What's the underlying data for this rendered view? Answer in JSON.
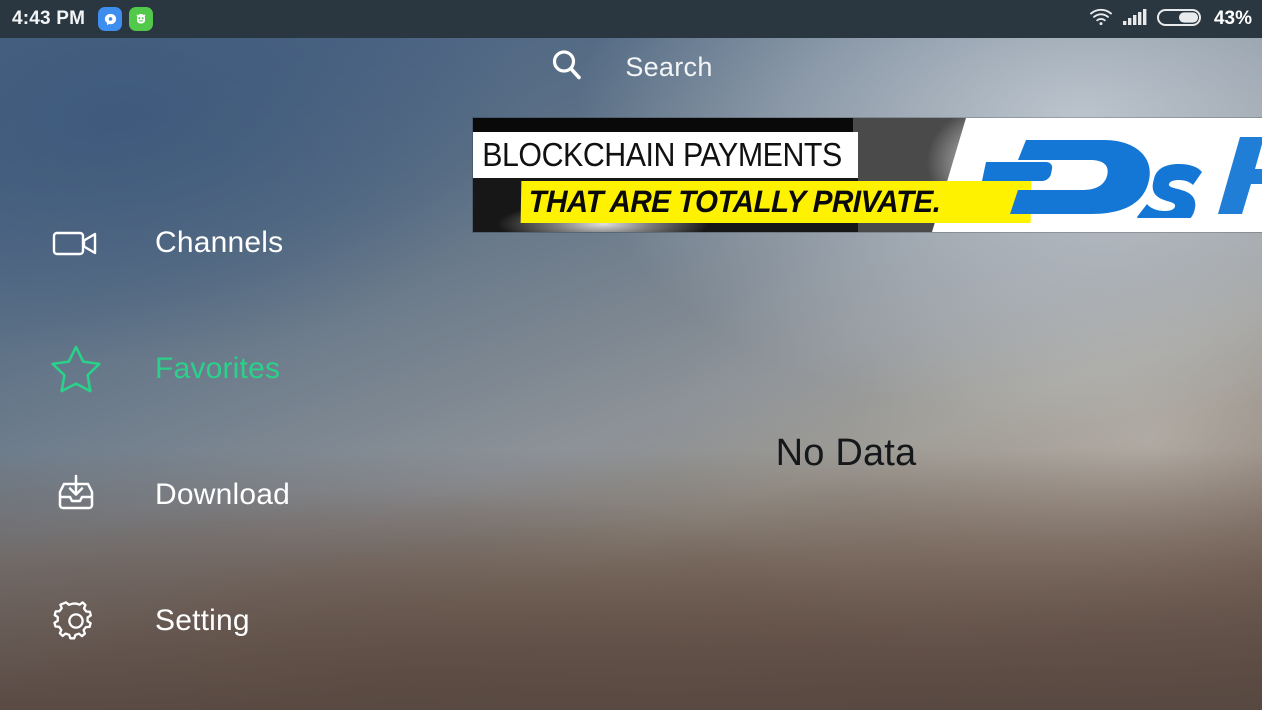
{
  "status_bar": {
    "time": "4:43 PM",
    "notification_icons": [
      {
        "name": "messenger-app-icon",
        "color": "#3e8ef0"
      },
      {
        "name": "green-robot-app-icon",
        "color": "#52c94a"
      }
    ],
    "wifi_icon": "wifi-icon",
    "signal_icon": "cellular-signal-icon",
    "battery_icon": "battery-icon",
    "battery_percent": "43%",
    "background_color": "#2a3740"
  },
  "search": {
    "icon": "search-icon",
    "label": "Search"
  },
  "banner_ad": {
    "name": "dash-blockchain-advertisement",
    "line1": "BLOCKCHAIN PAYMENTS",
    "line2": "THAT ARE TOTALLY PRIVATE.",
    "brand": "Dash",
    "highlight_color": "#fff200",
    "brand_color": "#1577d5"
  },
  "sidebar": {
    "items": [
      {
        "label": "Channels",
        "icon": "video-camera-icon",
        "active": false
      },
      {
        "label": "Favorites",
        "icon": "star-icon",
        "active": true
      },
      {
        "label": "Download",
        "icon": "download-tray-icon",
        "active": false
      },
      {
        "label": "Setting",
        "icon": "gear-icon",
        "active": false
      }
    ],
    "active_color": "#2ad18a",
    "inactive_color": "#ffffff"
  },
  "content": {
    "empty_state_text": "No Data"
  }
}
